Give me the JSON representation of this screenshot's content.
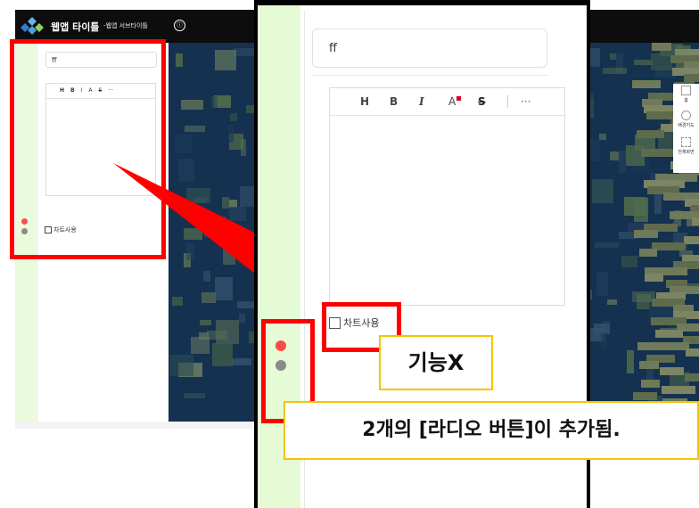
{
  "app": {
    "title": "웹앱 타이틀",
    "subtitle": "-웹앱 서브타이틀",
    "info_symbol": "ⓘ"
  },
  "editor": {
    "title_value": "ff",
    "toolbar": [
      "H",
      "B",
      "I",
      "A",
      "S",
      "···"
    ],
    "checkbox_label": "차트사용"
  },
  "map_controls": {
    "home": "홈",
    "basemap": "배경지도",
    "fullscreen": "전체화면"
  },
  "radios": [
    {
      "state": "selected",
      "color": "#ff4a4a"
    },
    {
      "state": "unselected",
      "color": "#8a8a8a"
    }
  ],
  "annotations": {
    "feature_x": "기능X",
    "radio_added": "2개의 [라디오 버튼]이 추가됨."
  },
  "colors": {
    "highlight": "#ff0000",
    "callout_border": "#f5c400",
    "rail": "#e4fbd5",
    "topbar": "#0d0d0d"
  }
}
